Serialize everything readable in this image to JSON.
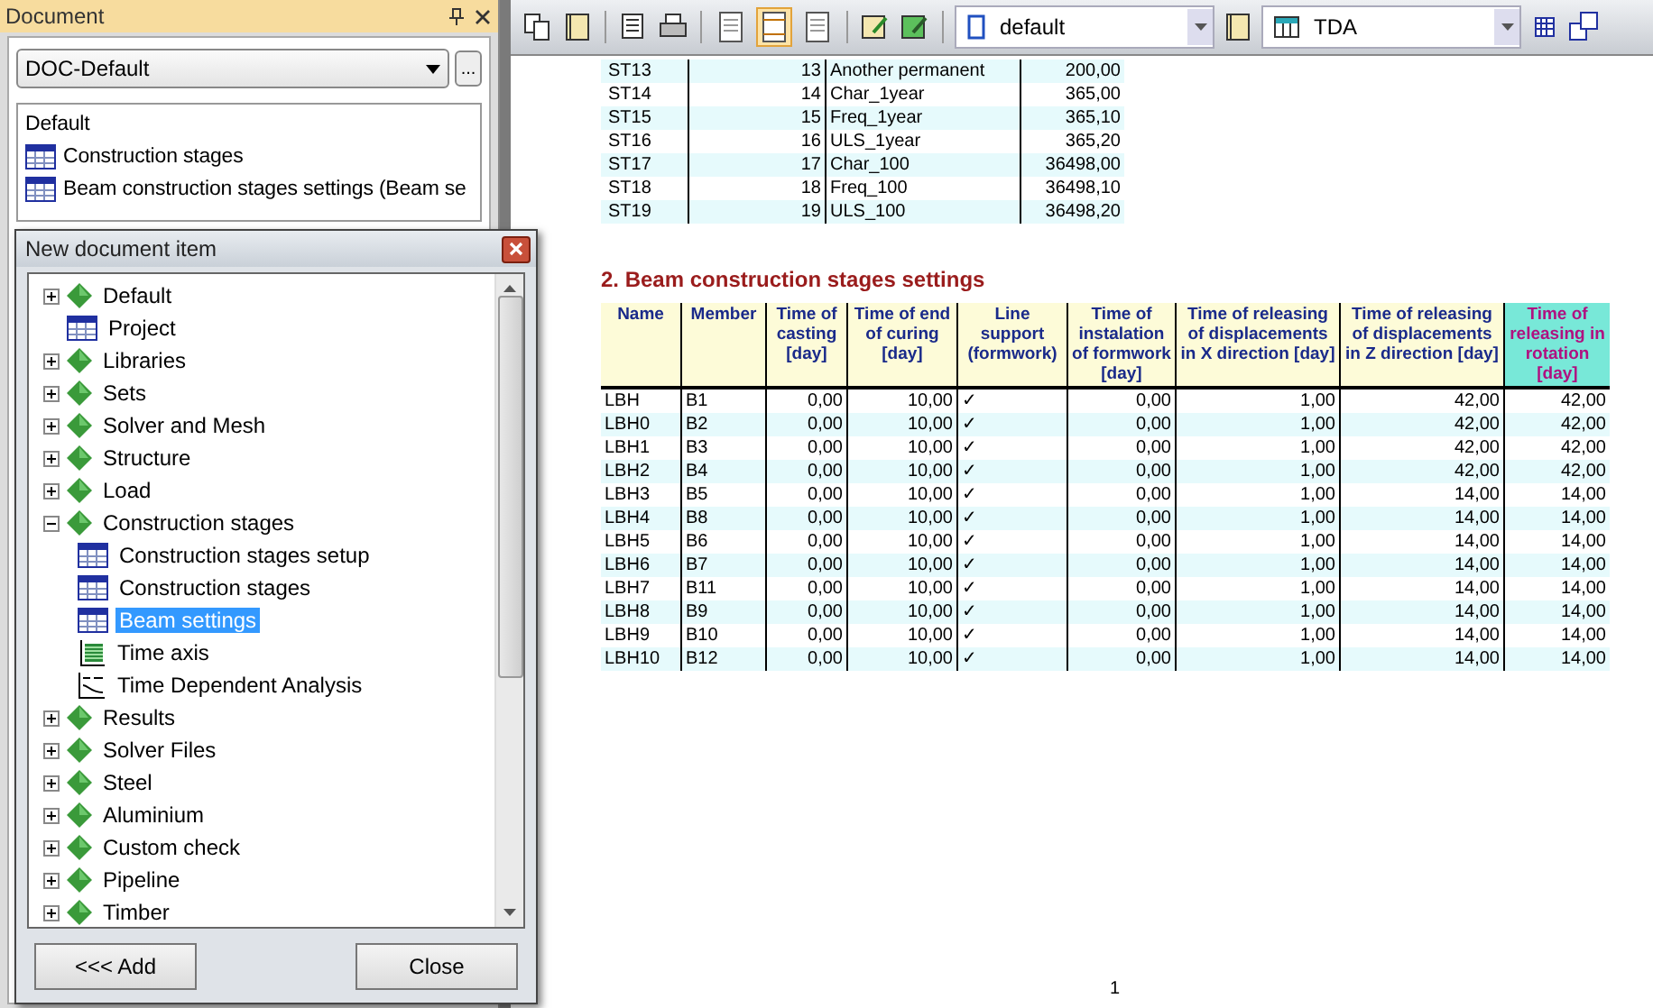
{
  "document_panel": {
    "title": "Document",
    "combo": {
      "value": "DOC-Default"
    },
    "more_button": "...",
    "list": {
      "header": "Default",
      "items": [
        {
          "label": "Construction stages"
        },
        {
          "label": "Beam construction stages settings (Beam se"
        }
      ]
    }
  },
  "dialog": {
    "title": "New document item",
    "tree": [
      {
        "label": "Default",
        "kind": "folder",
        "expanded": false,
        "selected": false
      },
      {
        "label": "Project",
        "kind": "table",
        "selected": false
      },
      {
        "label": "Libraries",
        "kind": "folder",
        "expanded": false,
        "selected": false
      },
      {
        "label": "Sets",
        "kind": "folder",
        "expanded": false,
        "selected": false
      },
      {
        "label": "Solver and Mesh",
        "kind": "folder",
        "expanded": false,
        "selected": false
      },
      {
        "label": "Structure",
        "kind": "folder",
        "expanded": false,
        "selected": false
      },
      {
        "label": "Load",
        "kind": "folder",
        "expanded": false,
        "selected": false
      },
      {
        "label": "Construction stages",
        "kind": "folder",
        "expanded": true,
        "selected": false,
        "children": [
          {
            "label": "Construction stages setup",
            "kind": "table",
            "selected": false
          },
          {
            "label": "Construction stages",
            "kind": "table",
            "selected": false
          },
          {
            "label": "Beam settings",
            "kind": "table",
            "selected": true
          },
          {
            "label": "Time axis",
            "kind": "axis",
            "selected": false
          },
          {
            "label": "Time Dependent Analysis",
            "kind": "tda",
            "selected": false
          }
        ]
      },
      {
        "label": "Results",
        "kind": "folder",
        "expanded": false,
        "selected": false
      },
      {
        "label": "Solver Files",
        "kind": "folder",
        "expanded": false,
        "selected": false
      },
      {
        "label": "Steel",
        "kind": "folder",
        "expanded": false,
        "selected": false
      },
      {
        "label": "Aluminium",
        "kind": "folder",
        "expanded": false,
        "selected": false
      },
      {
        "label": "Custom check",
        "kind": "folder",
        "expanded": false,
        "selected": false
      },
      {
        "label": "Pipeline",
        "kind": "folder",
        "expanded": false,
        "selected": false
      },
      {
        "label": "Timber",
        "kind": "folder",
        "expanded": false,
        "selected": false
      }
    ],
    "buttons": [
      "<<< Add",
      "Close"
    ]
  },
  "toolbar": {
    "layout_buttons": [
      {
        "selected": false
      },
      {
        "selected": true
      },
      {
        "selected": false
      }
    ],
    "template_combo": {
      "value": "default"
    },
    "view_combo": {
      "value": "TDA"
    }
  },
  "stages_table": {
    "rows": [
      [
        "ST13",
        "13",
        "Another permanent",
        "200,00"
      ],
      [
        "ST14",
        "14",
        "Char_1year",
        "365,00"
      ],
      [
        "ST15",
        "15",
        "Freq_1year",
        "365,10"
      ],
      [
        "ST16",
        "16",
        "ULS_1year",
        "365,20"
      ],
      [
        "ST17",
        "17",
        "Char_100",
        "36498,00"
      ],
      [
        "ST18",
        "18",
        "Freq_100",
        "36498,10"
      ],
      [
        "ST19",
        "19",
        "ULS_100",
        "36498,20"
      ]
    ]
  },
  "beam_section": {
    "heading": "2. Beam construction stages settings",
    "columns": [
      {
        "label": "Name",
        "selected": false
      },
      {
        "label": "Member",
        "selected": false
      },
      {
        "label": "Time of casting [day]",
        "selected": false
      },
      {
        "label": "Time of end of curing [day]",
        "selected": false
      },
      {
        "label": "Line support (formwork)",
        "selected": false
      },
      {
        "label": "Time of instalation of formwork [day]",
        "selected": false
      },
      {
        "label": "Time of releasing of displacements in X direction [day]",
        "selected": false
      },
      {
        "label": "Time of releasing of displacements in Z direction [day]",
        "selected": false
      },
      {
        "label": "Time of releasing in rotation [day]",
        "selected": true
      }
    ],
    "rows": [
      [
        "LBH",
        "B1",
        "0,00",
        "10,00",
        "✓",
        "0,00",
        "1,00",
        "42,00",
        "42,00"
      ],
      [
        "LBH0",
        "B2",
        "0,00",
        "10,00",
        "✓",
        "0,00",
        "1,00",
        "42,00",
        "42,00"
      ],
      [
        "LBH1",
        "B3",
        "0,00",
        "10,00",
        "✓",
        "0,00",
        "1,00",
        "42,00",
        "42,00"
      ],
      [
        "LBH2",
        "B4",
        "0,00",
        "10,00",
        "✓",
        "0,00",
        "1,00",
        "42,00",
        "42,00"
      ],
      [
        "LBH3",
        "B5",
        "0,00",
        "10,00",
        "✓",
        "0,00",
        "1,00",
        "14,00",
        "14,00"
      ],
      [
        "LBH4",
        "B8",
        "0,00",
        "10,00",
        "✓",
        "0,00",
        "1,00",
        "14,00",
        "14,00"
      ],
      [
        "LBH5",
        "B6",
        "0,00",
        "10,00",
        "✓",
        "0,00",
        "1,00",
        "14,00",
        "14,00"
      ],
      [
        "LBH6",
        "B7",
        "0,00",
        "10,00",
        "✓",
        "0,00",
        "1,00",
        "14,00",
        "14,00"
      ],
      [
        "LBH7",
        "B11",
        "0,00",
        "10,00",
        "✓",
        "0,00",
        "1,00",
        "14,00",
        "14,00"
      ],
      [
        "LBH8",
        "B9",
        "0,00",
        "10,00",
        "✓",
        "0,00",
        "1,00",
        "14,00",
        "14,00"
      ],
      [
        "LBH9",
        "B10",
        "0,00",
        "10,00",
        "✓",
        "0,00",
        "1,00",
        "14,00",
        "14,00"
      ],
      [
        "LBH10",
        "B12",
        "0,00",
        "10,00",
        "✓",
        "0,00",
        "1,00",
        "14,00",
        "14,00"
      ]
    ]
  },
  "page_number": "1"
}
